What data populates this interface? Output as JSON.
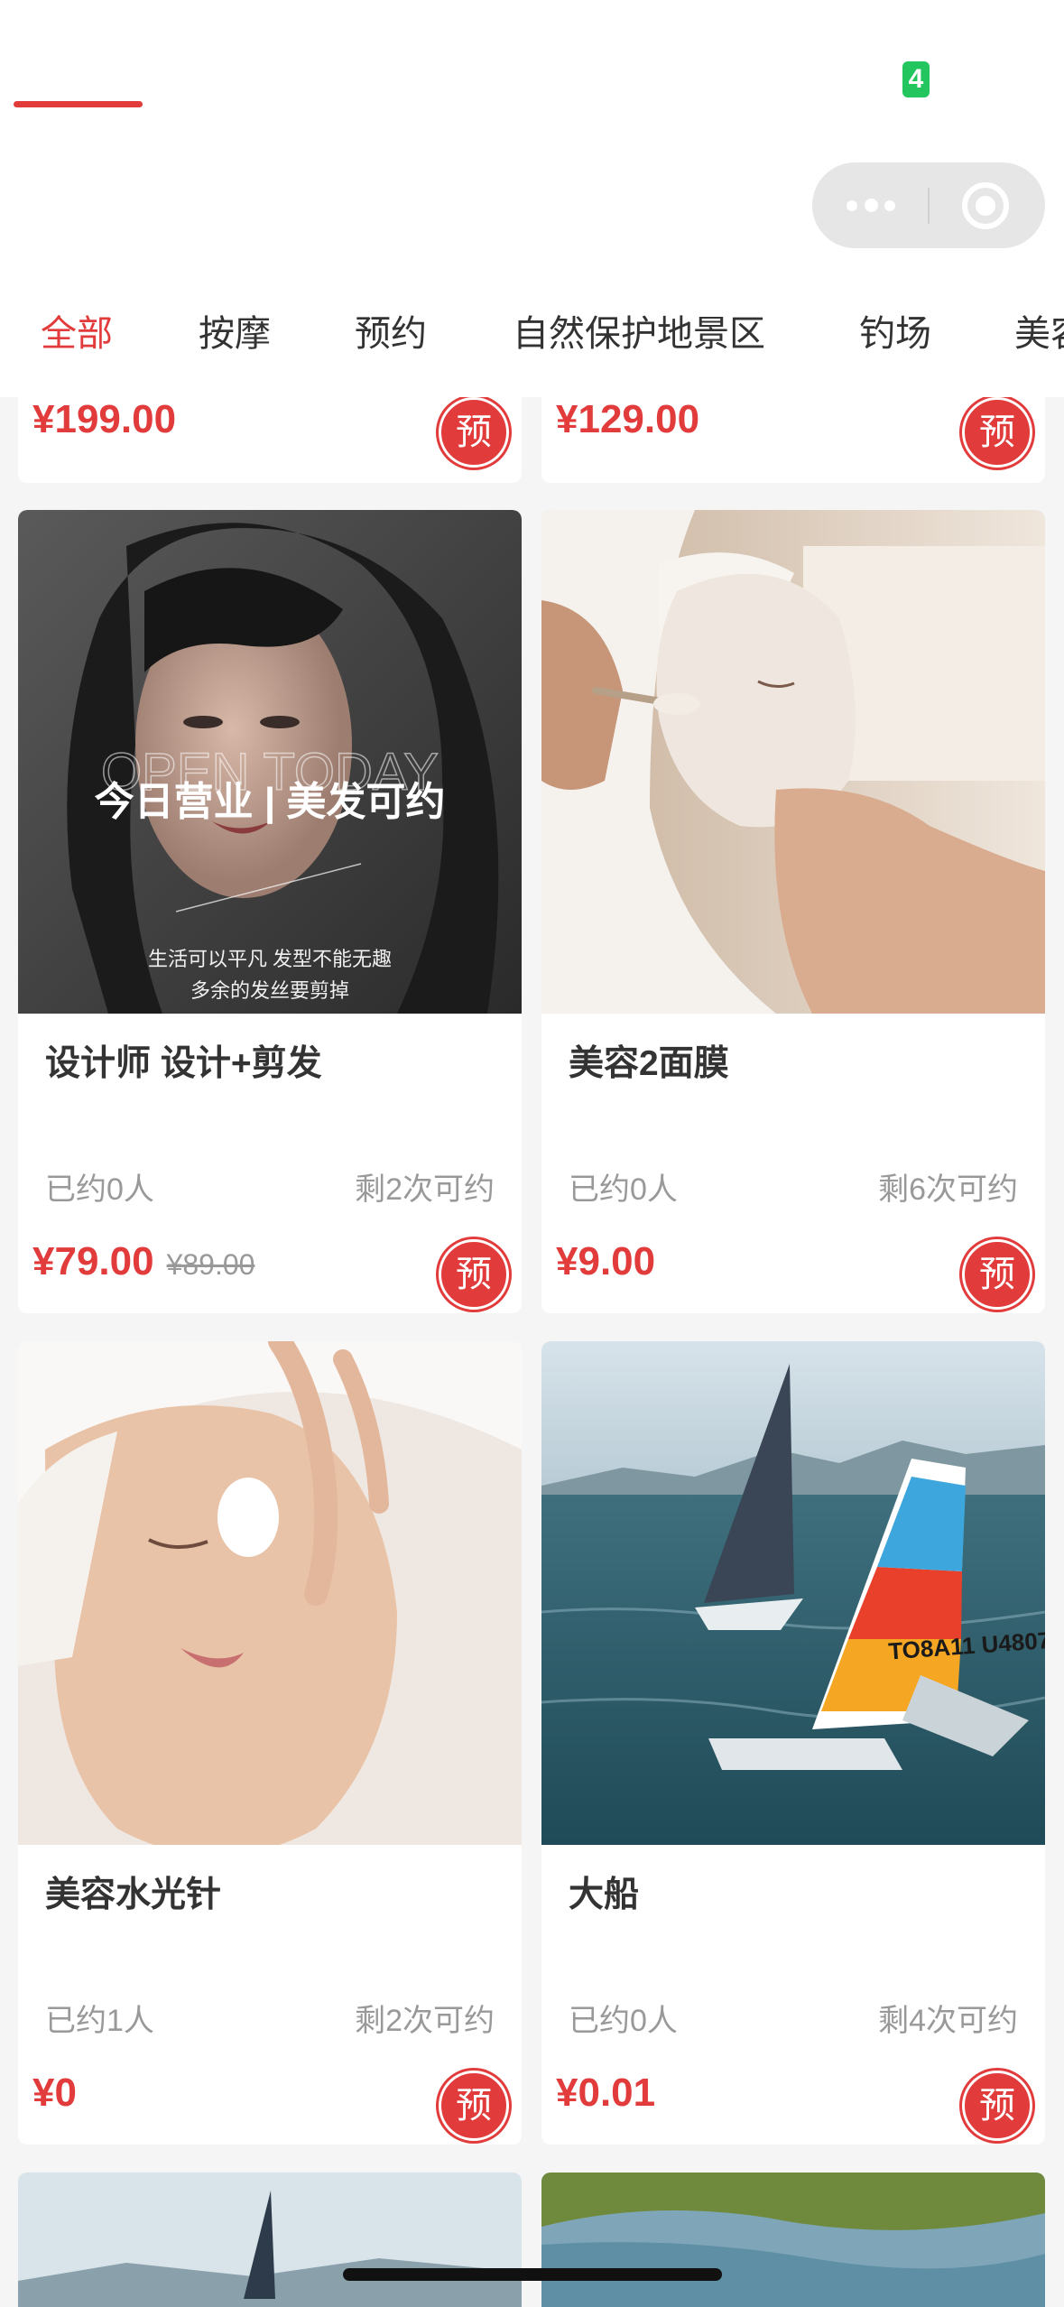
{
  "status": {
    "badge": "4"
  },
  "tabs": [
    {
      "label": "全部",
      "active": true
    },
    {
      "label": "按摩"
    },
    {
      "label": "预约"
    },
    {
      "label": "自然保护地景区"
    },
    {
      "label": "钓场"
    },
    {
      "label": "美容"
    }
  ],
  "accent_color": "#e23b3b",
  "book_label": "预",
  "top_row": [
    {
      "price": "¥199.00"
    },
    {
      "price": "¥129.00"
    }
  ],
  "cards": [
    {
      "title": "设计师 设计+剪发",
      "booked": "已约0人",
      "remaining": "剩2次可约",
      "price": "¥79.00",
      "original_price": "¥89.00",
      "image": {
        "overlay_en": "OPEN TODAY",
        "overlay_title": "今日营业 | 美发可约",
        "overlay_line1": "生活可以平凡 发型不能无趣",
        "overlay_line2": "多余的发丝要剪掉"
      }
    },
    {
      "title": "美容2面膜",
      "booked": "已约0人",
      "remaining": "剩6次可约",
      "price": "¥9.00"
    },
    {
      "title": "美容水光针",
      "booked": "已约1人",
      "remaining": "剩2次可约",
      "price": "¥0"
    },
    {
      "title": "大船",
      "booked": "已约0人",
      "remaining": "剩4次可约",
      "price": "¥0.01",
      "image": {
        "sail_text": "ТО8А11 U4807"
      }
    }
  ]
}
